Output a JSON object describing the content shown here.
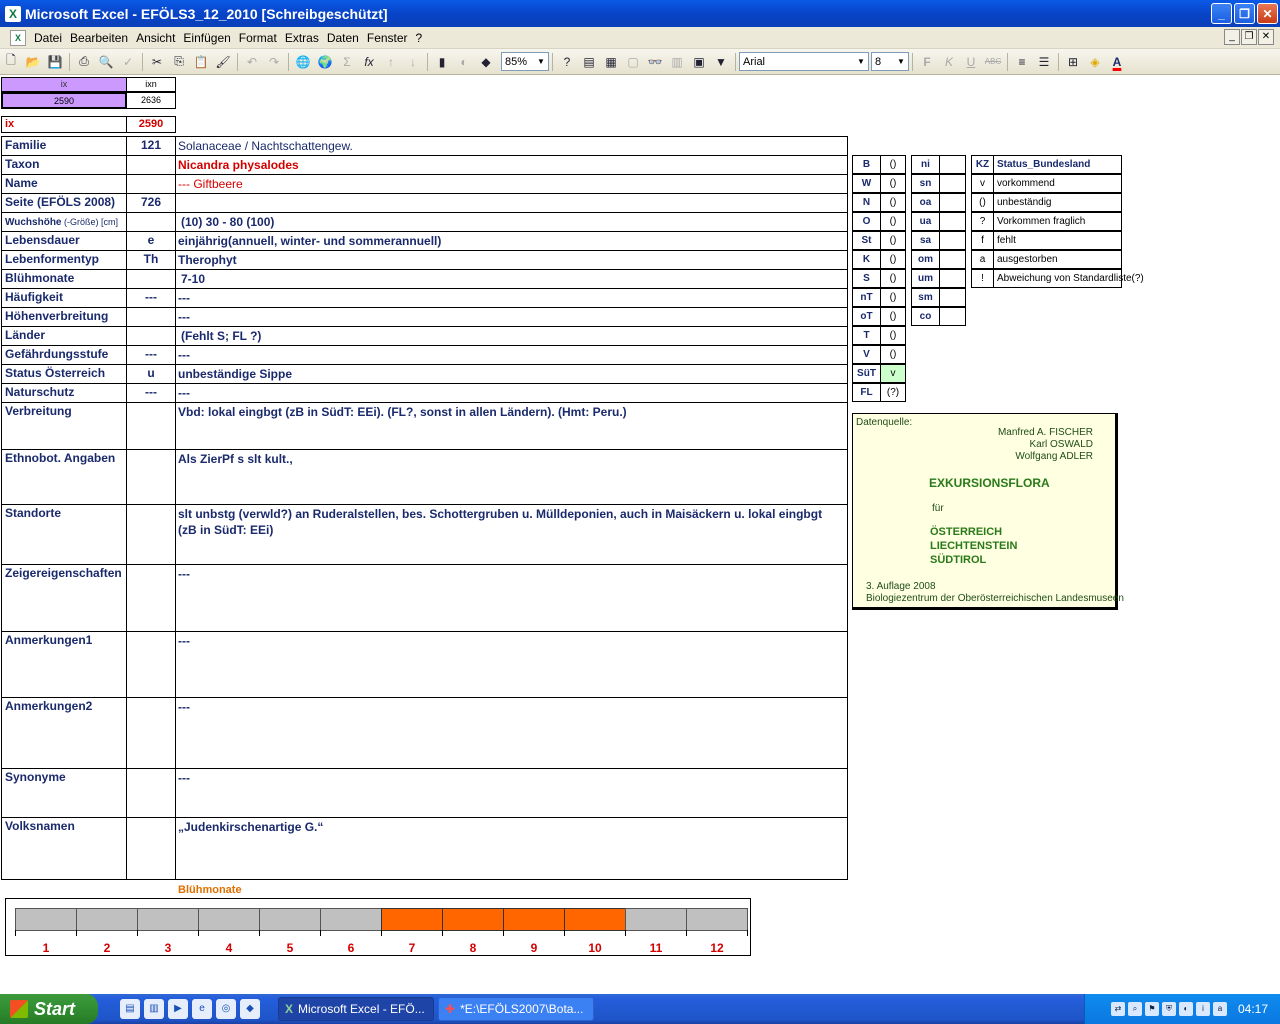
{
  "window": {
    "title": "Microsoft Excel - EFÖLS3_12_2010  [Schreibgeschützt]",
    "app_icon": "excel-icon"
  },
  "menu": [
    "Datei",
    "Bearbeiten",
    "Ansicht",
    "Einfügen",
    "Format",
    "Extras",
    "Daten",
    "Fenster",
    "?"
  ],
  "toolbar": {
    "zoom": "85%",
    "font": "Arial",
    "size": "8",
    "bold": "F",
    "italic": "K",
    "underline": "U",
    "strike": "ABC"
  },
  "index": {
    "ix_header": "ix",
    "ixn_header": "ixn",
    "ix_value": "2590",
    "ixn_value": "2636",
    "ix_label": "ix",
    "ix_red": "2590"
  },
  "rows": [
    {
      "label": "Familie",
      "num": "121",
      "value": "Solanaceae  /  Nachtschattengew."
    },
    {
      "label": "Taxon",
      "num": "",
      "value": "Nicandra physalodes"
    },
    {
      "label": "Name",
      "num": "",
      "value": "--- Giftbeere"
    },
    {
      "label": "Seite (EFÖLS 2008)",
      "num": "726",
      "value": ""
    },
    {
      "label": "Wuchshöhe",
      "label_small": " (-Größe) [cm]",
      "num": "",
      "value": "(10) 30 - 80 (100)"
    },
    {
      "label": "Lebensdauer",
      "num": "e",
      "value": "einjährig(annuell, winter- und sommerannuell)"
    },
    {
      "label": "Lebenformentyp",
      "num": "Th",
      "value": "Therophyt"
    },
    {
      "label": "Blühmonate",
      "num": "",
      "value": "7-10"
    },
    {
      "label": "Häufigkeit",
      "num": "---",
      "value": "---"
    },
    {
      "label": "Höhenverbreitung",
      "num": "",
      "value": "---"
    },
    {
      "label": "Länder",
      "num": "",
      "value": "(Fehlt S; FL ?)"
    },
    {
      "label": "Gefährdungsstufe",
      "num": "---",
      "value": "---"
    },
    {
      "label": "Status Österreich",
      "num": "u",
      "value": "unbeständige Sippe"
    },
    {
      "label": "Naturschutz",
      "num": "---",
      "value": "---"
    }
  ],
  "blocks": [
    {
      "label": "Verbreitung",
      "value": "Vbd:  lokal eingbgt (zB in SüdT: EEi). (FL?, sonst in allen Ländern). (Hmt: Peru.)"
    },
    {
      "label": "Ethnobot. Angaben",
      "value": "Als ZierPf s slt kult.,"
    },
    {
      "label": "Standorte",
      "value": "slt unbstg (verwld?) an Ruderalstellen, bes. Schottergruben u. Mülldeponien, auch in Maisäckern u. lokal eingbgt (zB in SüdT: EEi)"
    },
    {
      "label": "Zeigereigenschaften",
      "value": "---"
    },
    {
      "label": "Anmerkungen1",
      "value": "---"
    },
    {
      "label": "Anmerkungen2",
      "value": "---"
    },
    {
      "label": "Synonyme",
      "value": "---"
    },
    {
      "label": "Volksnamen",
      "value": "„Judenkirschenartige G.“"
    }
  ],
  "states": [
    {
      "code": "B",
      "val": "()"
    },
    {
      "code": "W",
      "val": "()"
    },
    {
      "code": "N",
      "val": "()"
    },
    {
      "code": "O",
      "val": "()"
    },
    {
      "code": "St",
      "val": "()"
    },
    {
      "code": "K",
      "val": "()"
    },
    {
      "code": "S",
      "val": "()"
    },
    {
      "code": "nT",
      "val": "()"
    },
    {
      "code": "oT",
      "val": "()"
    },
    {
      "code": "T",
      "val": "()"
    },
    {
      "code": "V",
      "val": "()"
    },
    {
      "code": "SüT",
      "val": "v"
    },
    {
      "code": "FL",
      "val": "(?)"
    }
  ],
  "zones": [
    "ni",
    "sn",
    "oa",
    "ua",
    "sa",
    "om",
    "um",
    "sm",
    "co"
  ],
  "legend": {
    "h_kz": "KZ",
    "h_status": "Status_Bundesland",
    "items": [
      {
        "kz": "v",
        "text": "vorkommend"
      },
      {
        "kz": "()",
        "text": "unbeständig"
      },
      {
        "kz": "?",
        "text": "Vorkommen fraglich"
      },
      {
        "kz": "f",
        "text": "fehlt"
      },
      {
        "kz": "a",
        "text": "ausgestorben"
      },
      {
        "kz": "!",
        "text": "Abweichung von Standardliste(?)"
      }
    ]
  },
  "source": {
    "label": "Datenquelle:",
    "authors": [
      "Manfred A. FISCHER",
      "Karl OSWALD",
      "Wolfgang ADLER"
    ],
    "title": "EXKURSIONSFLORA",
    "fuer": "für",
    "countries": [
      "ÖSTERREICH",
      "LIECHTENSTEIN",
      "SÜDTIROL"
    ],
    "edition": "3. Auflage 2008",
    "publisher": "Biologiezentrum der Oberösterreichischen Landesmuseen"
  },
  "months": {
    "label": "Blühmonate",
    "numbers": [
      "1",
      "2",
      "3",
      "4",
      "5",
      "6",
      "7",
      "8",
      "9",
      "10",
      "11",
      "12"
    ],
    "bloom": [
      7,
      8,
      9,
      10
    ]
  },
  "colors": {
    "highlight": "#cc99ff",
    "bloom": "#ff6600",
    "off": "#c0c0c0",
    "source_bg": "#ffffe1"
  },
  "taskbar": {
    "start": "Start",
    "tasks": [
      "Microsoft Excel - EFÖ...",
      "*E:\\EFÖLS2007\\Bota..."
    ],
    "time": "04:17"
  }
}
